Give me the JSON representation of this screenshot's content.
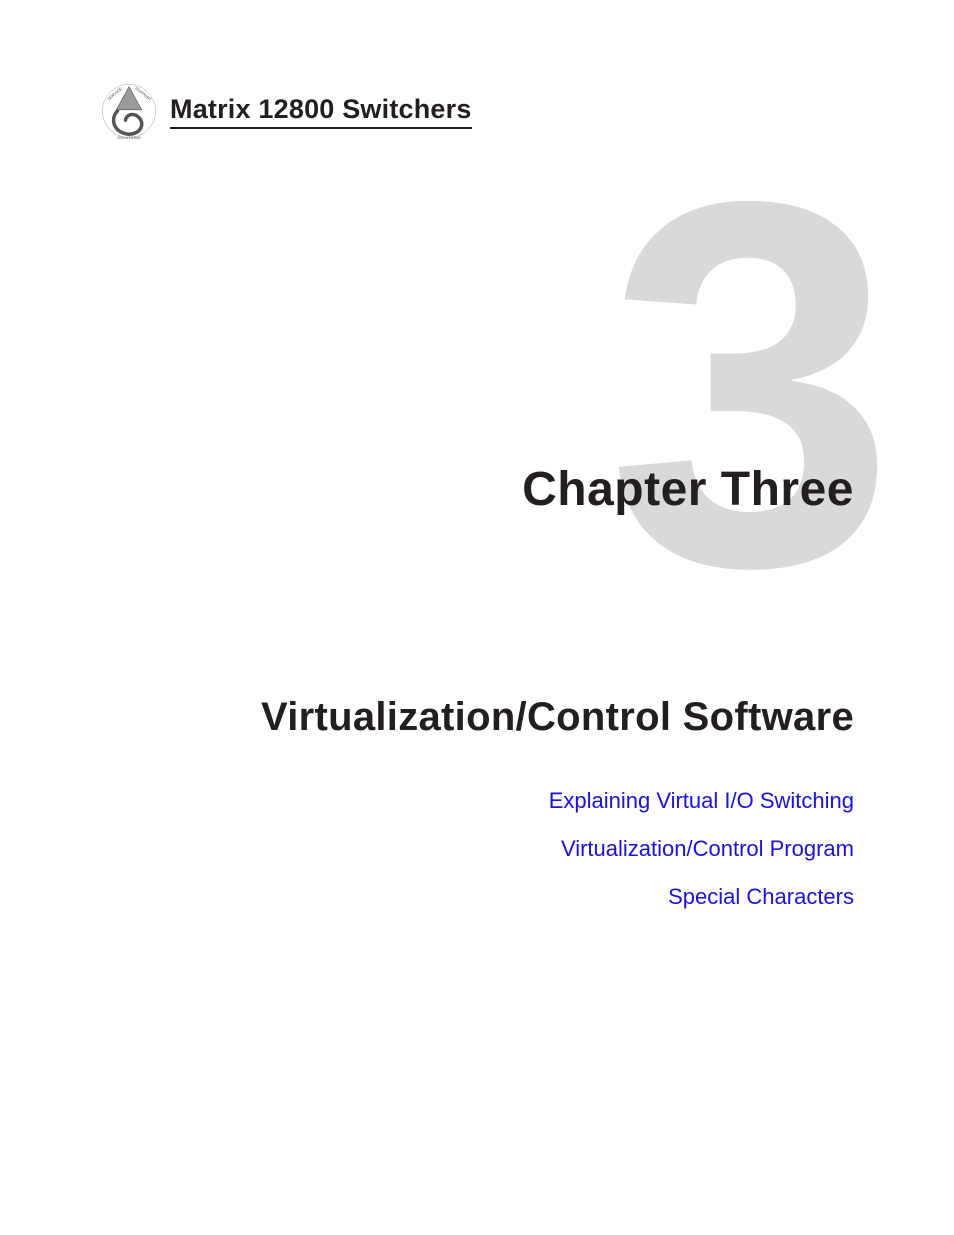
{
  "header": {
    "product_title": "Matrix 12800 Switchers"
  },
  "chapter": {
    "number_watermark": "3",
    "label": "Chapter Three",
    "title": "Virtualization/Control Software"
  },
  "links": [
    "Explaining Virtual I/O Switching",
    "Virtualization/Control Program",
    "Special Characters"
  ]
}
